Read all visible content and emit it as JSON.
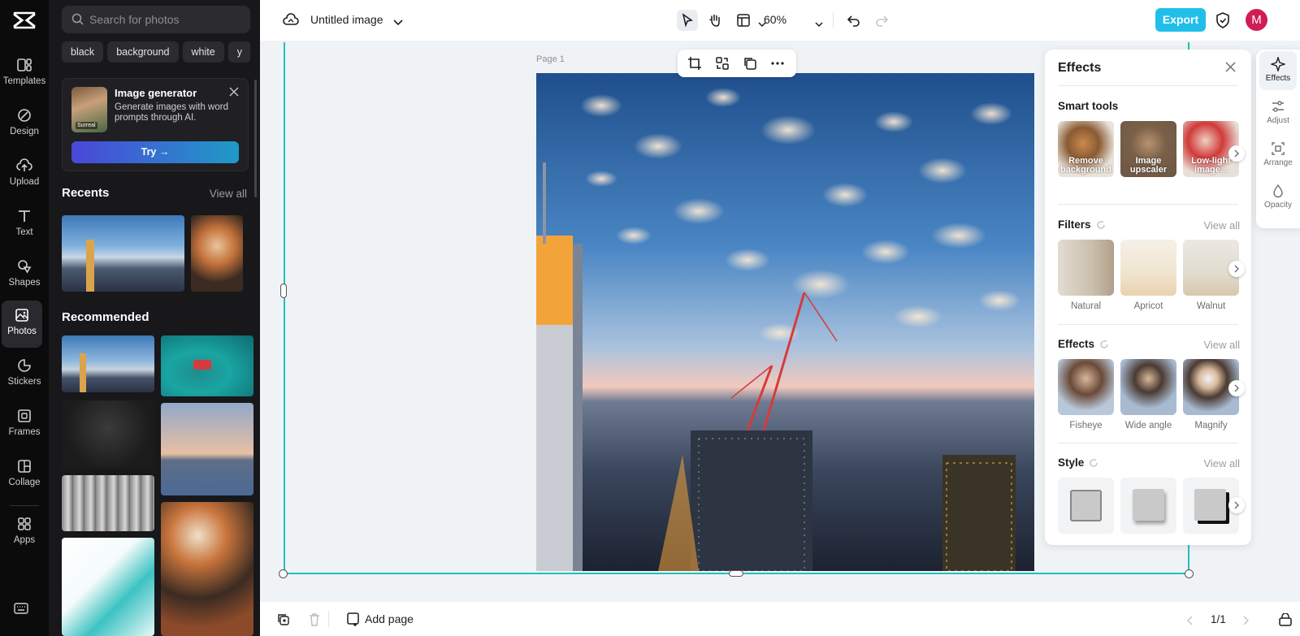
{
  "rail": {
    "logo_icon": "capcut-logo-icon",
    "items": [
      {
        "label": "Templates",
        "icon": "templates-icon"
      },
      {
        "label": "Design",
        "icon": "design-icon"
      },
      {
        "label": "Upload",
        "icon": "upload-icon"
      },
      {
        "label": "Text",
        "icon": "text-icon"
      },
      {
        "label": "Shapes",
        "icon": "shapes-icon"
      },
      {
        "label": "Photos",
        "icon": "photos-icon",
        "active": true
      },
      {
        "label": "Stickers",
        "icon": "stickers-icon"
      },
      {
        "label": "Frames",
        "icon": "frames-icon"
      },
      {
        "label": "Collage",
        "icon": "collage-icon"
      },
      {
        "label": "Apps",
        "icon": "apps-icon"
      }
    ],
    "keyboard_icon": "keyboard-icon"
  },
  "photos_panel": {
    "search_placeholder": "Search for photos",
    "chips": [
      "black",
      "background",
      "white",
      "y"
    ],
    "generator": {
      "badge": "Surreal",
      "title": "Image generator",
      "description": "Generate images with word prompts through AI.",
      "try_label": "Try →"
    },
    "recents_title": "Recents",
    "recents_view_all": "View all",
    "recommended_title": "Recommended"
  },
  "topbar": {
    "title": "Untitled image",
    "zoom": "60%",
    "export_label": "Export",
    "avatar_initial": "M"
  },
  "canvas": {
    "page_label": "Page 1"
  },
  "bottombar": {
    "add_page_label": "Add page",
    "pager": "1/1"
  },
  "effects": {
    "title": "Effects",
    "smart_tools_title": "Smart tools",
    "smart_tools": [
      "Remove background",
      "Image upscaler",
      "Low-light image..."
    ],
    "filters_title": "Filters",
    "filters_view_all": "View all",
    "filters": [
      "Natural",
      "Apricot",
      "Walnut"
    ],
    "effects_title": "Effects",
    "effects_view_all": "View all",
    "effects_items": [
      "Fisheye",
      "Wide angle",
      "Magnify"
    ],
    "style_title": "Style",
    "style_view_all": "View all"
  },
  "right_rail": {
    "items": [
      {
        "label": "Effects",
        "icon": "effects-icon",
        "active": true
      },
      {
        "label": "Adjust",
        "icon": "adjust-icon"
      },
      {
        "label": "Arrange",
        "icon": "arrange-icon"
      },
      {
        "label": "Opacity",
        "icon": "opacity-icon"
      }
    ]
  },
  "colors": {
    "accent": "#20bfea",
    "selection": "#20bfbf",
    "avatar": "#d11c55",
    "rail_bg": "#0b0b0c",
    "panel_bg": "#18181b"
  }
}
